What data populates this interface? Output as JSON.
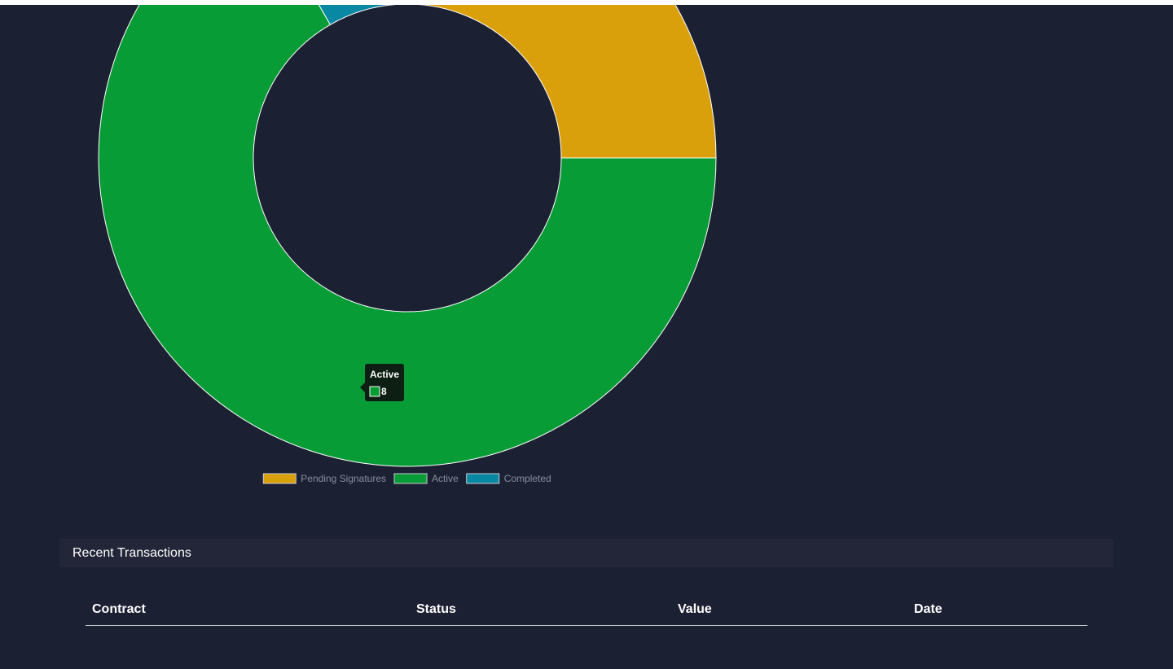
{
  "chart_data": {
    "type": "doughnut",
    "categories": [
      "Pending Signatures",
      "Active",
      "Completed"
    ],
    "values": [
      3,
      8,
      1
    ],
    "colors": [
      "#d9a00b",
      "#079c35",
      "#0888a3"
    ],
    "legend": {
      "position": "bottom",
      "entries": [
        "Pending Signatures",
        "Active",
        "Completed"
      ]
    },
    "tooltip": {
      "label": "Active",
      "value": "8",
      "color": "#079c35"
    }
  },
  "transactions": {
    "title": "Recent Transactions",
    "columns": [
      "Contract",
      "Status",
      "Value",
      "Date"
    ]
  }
}
